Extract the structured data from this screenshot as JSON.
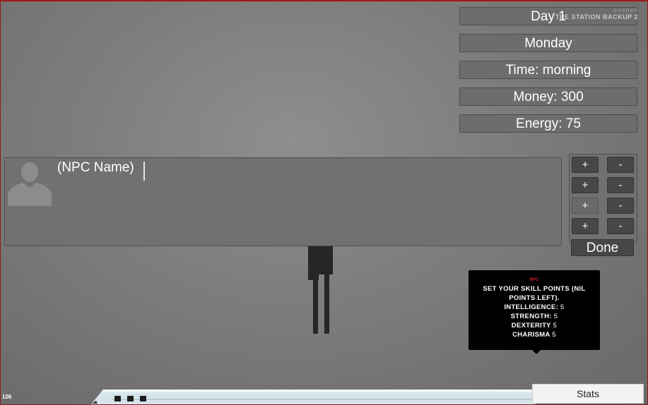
{
  "hud": {
    "day": "Day 1",
    "weekday": "Monday",
    "time": "Time: morning",
    "money": "Money: 300",
    "energy": "Energy: 75"
  },
  "watermark": {
    "dots": "○○○○○○",
    "title": "THE STATION BACKUP 2"
  },
  "dialog": {
    "npc_name": "(NPC Name)"
  },
  "skills": {
    "buttons": [
      {
        "plus": "+",
        "minus": "-"
      },
      {
        "plus": "+",
        "minus": "-"
      },
      {
        "plus": "+",
        "minus": "-"
      },
      {
        "plus": "+",
        "minus": "-"
      }
    ],
    "done_label": "Done"
  },
  "tooltip": {
    "speaker": "NPC",
    "message": "SET YOUR SKILL POINTS (NIL POINTS LEFT).",
    "stats": [
      {
        "label": "INTELLIGENCE:",
        "value": "5"
      },
      {
        "label": "STRENGTH:",
        "value": "5"
      },
      {
        "label": "DEXTERITY",
        "value": "5"
      },
      {
        "label": "CHARISMA",
        "value": "5"
      }
    ]
  },
  "footer": {
    "stats_label": "Stats",
    "fps": "106"
  }
}
